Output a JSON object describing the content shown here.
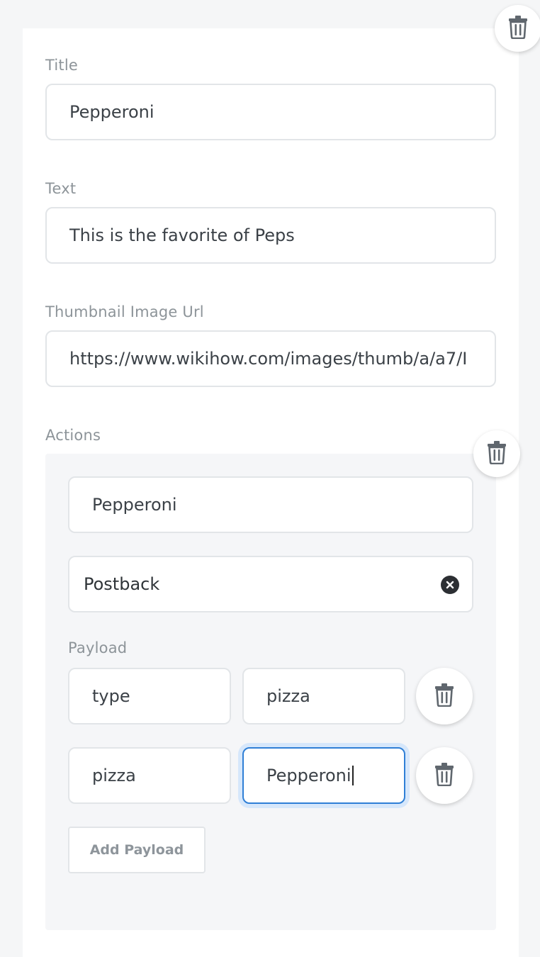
{
  "card": {
    "delete_icon": "trash-icon",
    "title": {
      "label": "Title",
      "value": "Pepperoni"
    },
    "text": {
      "label": "Text",
      "value": "This is the favorite of Peps"
    },
    "thumbnail": {
      "label": "Thumbnail Image Url",
      "value": "https://www.wikihow.com/images/thumb/a/a7/I"
    },
    "actions": {
      "label": "Actions",
      "delete_icon": "trash-icon",
      "items": [
        {
          "title_value": "Pepperoni",
          "type_value": "Postback",
          "clear_icon": "close-icon",
          "payload": {
            "label": "Payload",
            "rows": [
              {
                "key": "type",
                "value": "pizza",
                "delete_icon": "trash-icon"
              },
              {
                "key": "pizza",
                "value": "Pepperoni",
                "delete_icon": "trash-icon"
              }
            ],
            "add_label": "Add Payload"
          }
        }
      ]
    }
  },
  "colors": {
    "background": "#f5f6f7",
    "card": "#ffffff",
    "panel": "#f5f6f8",
    "focus_border": "#2f7fd6",
    "focus_ring": "#d6e7fb",
    "label": "#8d9499"
  }
}
